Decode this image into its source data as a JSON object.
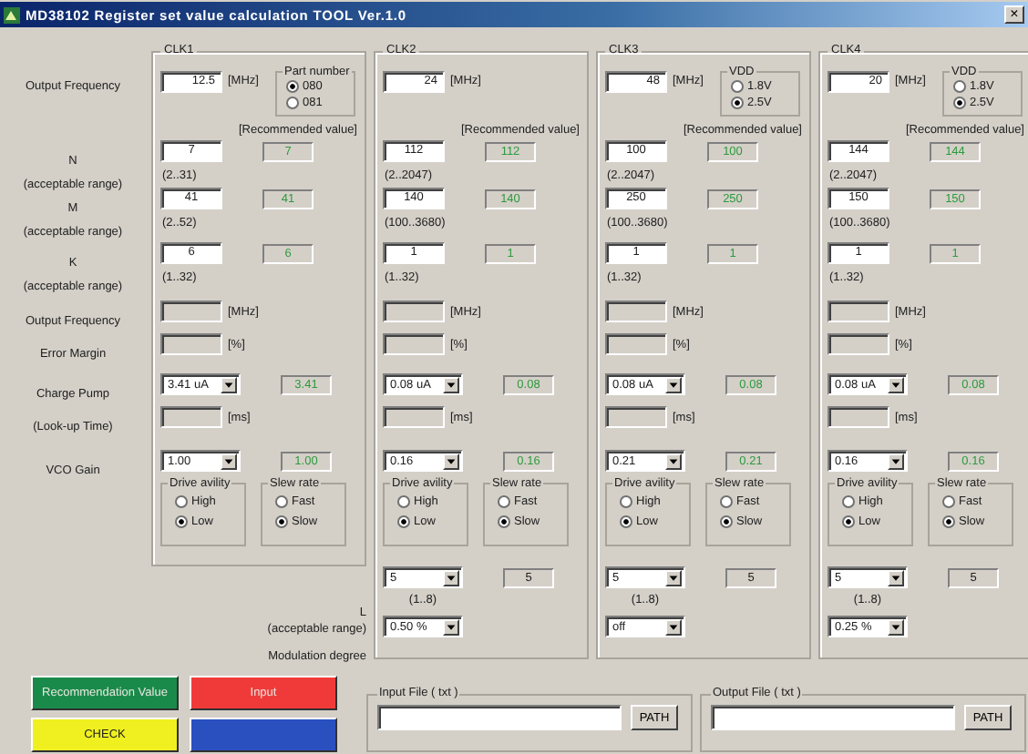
{
  "window": {
    "title": "MD38102 Register set value calculation TOOL Ver.1.0",
    "close": "×"
  },
  "label_column": {
    "output_frequency": "Output Frequency",
    "n": "N",
    "n_range": "(acceptable range)",
    "m": "M",
    "m_range": "(acceptable range)",
    "k": "K",
    "k_range": "(acceptable range)",
    "output_frequency_2": "Output Frequency",
    "error_margin": "Error Margin",
    "charge_pump": "Charge Pump",
    "lookup_time": "(Look-up Time)",
    "vco_gain": "VCO Gain",
    "l": "L",
    "l_range": "(acceptable range)",
    "modulation_degree": "Modulation degree"
  },
  "clocks": [
    {
      "title": "CLK1",
      "frequency": "12.5",
      "frequency_unit": "[MHz]",
      "option_group": {
        "title": "Part number",
        "options": [
          {
            "label": "080",
            "selected": true
          },
          {
            "label": "081",
            "selected": false
          }
        ]
      },
      "recommended_header": "[Recommended value]",
      "n": {
        "value": "7",
        "recommended": "7",
        "range": "(2..31)"
      },
      "m": {
        "value": "41",
        "recommended": "41",
        "range": "(2..52)"
      },
      "k": {
        "value": "6",
        "recommended": "6",
        "range": "(1..32)"
      },
      "output_frequency_unit": "[MHz]",
      "error_margin_unit": "[%]",
      "charge_pump": {
        "value": "3.41 uA",
        "recommended": "3.41"
      },
      "lookup_time_unit": "[ms]",
      "vco_gain": {
        "value": "1.00",
        "recommended": "1.00"
      },
      "drive_ability": {
        "title": "Drive avility",
        "options": [
          {
            "label": "High",
            "selected": false
          },
          {
            "label": "Low",
            "selected": true
          }
        ]
      },
      "slew_rate": {
        "title": "Slew rate",
        "options": [
          {
            "label": "Fast",
            "selected": false
          },
          {
            "label": "Slow",
            "selected": true
          }
        ]
      }
    },
    {
      "title": "CLK2",
      "frequency": "24",
      "frequency_unit": "[MHz]",
      "recommended_header": "[Recommended value]",
      "n": {
        "value": "112",
        "recommended": "112",
        "range": "(2..2047)"
      },
      "m": {
        "value": "140",
        "recommended": "140",
        "range": "(100..3680)"
      },
      "k": {
        "value": "1",
        "recommended": "1",
        "range": "(1..32)"
      },
      "output_frequency_unit": "[MHz]",
      "error_margin_unit": "[%]",
      "charge_pump": {
        "value": "0.08 uA",
        "recommended": "0.08"
      },
      "lookup_time_unit": "[ms]",
      "vco_gain": {
        "value": "0.16",
        "recommended": "0.16"
      },
      "drive_ability": {
        "title": "Drive avility",
        "options": [
          {
            "label": "High",
            "selected": false
          },
          {
            "label": "Low",
            "selected": true
          }
        ]
      },
      "slew_rate": {
        "title": "Slew rate",
        "options": [
          {
            "label": "Fast",
            "selected": false
          },
          {
            "label": "Slow",
            "selected": true
          }
        ]
      },
      "l": {
        "value": "5",
        "recommended": "5",
        "range": "(1..8)"
      },
      "modulation": "0.50 %"
    },
    {
      "title": "CLK3",
      "frequency": "48",
      "frequency_unit": "[MHz]",
      "option_group": {
        "title": "VDD",
        "options": [
          {
            "label": "1.8V",
            "selected": false
          },
          {
            "label": "2.5V",
            "selected": true
          }
        ]
      },
      "recommended_header": "[Recommended value]",
      "n": {
        "value": "100",
        "recommended": "100",
        "range": "(2..2047)"
      },
      "m": {
        "value": "250",
        "recommended": "250",
        "range": "(100..3680)"
      },
      "k": {
        "value": "1",
        "recommended": "1",
        "range": "(1..32)"
      },
      "output_frequency_unit": "[MHz]",
      "error_margin_unit": "[%]",
      "charge_pump": {
        "value": "0.08 uA",
        "recommended": "0.08"
      },
      "lookup_time_unit": "[ms]",
      "vco_gain": {
        "value": "0.21",
        "recommended": "0.21"
      },
      "drive_ability": {
        "title": "Drive avility",
        "options": [
          {
            "label": "High",
            "selected": false
          },
          {
            "label": "Low",
            "selected": true
          }
        ]
      },
      "slew_rate": {
        "title": "Slew rate",
        "options": [
          {
            "label": "Fast",
            "selected": false
          },
          {
            "label": "Slow",
            "selected": true
          }
        ]
      },
      "l": {
        "value": "5",
        "recommended": "5",
        "range": "(1..8)"
      },
      "modulation": "off"
    },
    {
      "title": "CLK4",
      "frequency": "20",
      "frequency_unit": "[MHz]",
      "option_group": {
        "title": "VDD",
        "options": [
          {
            "label": "1.8V",
            "selected": false
          },
          {
            "label": "2.5V",
            "selected": true
          }
        ]
      },
      "recommended_header": "[Recommended value]",
      "n": {
        "value": "144",
        "recommended": "144",
        "range": "(2..2047)"
      },
      "m": {
        "value": "150",
        "recommended": "150",
        "range": "(100..3680)"
      },
      "k": {
        "value": "1",
        "recommended": "1",
        "range": "(1..32)"
      },
      "output_frequency_unit": "[MHz]",
      "error_margin_unit": "[%]",
      "charge_pump": {
        "value": "0.08 uA",
        "recommended": "0.08"
      },
      "lookup_time_unit": "[ms]",
      "vco_gain": {
        "value": "0.16",
        "recommended": "0.16"
      },
      "drive_ability": {
        "title": "Drive avility",
        "options": [
          {
            "label": "High",
            "selected": false
          },
          {
            "label": "Low",
            "selected": true
          }
        ]
      },
      "slew_rate": {
        "title": "Slew rate",
        "options": [
          {
            "label": "Fast",
            "selected": false
          },
          {
            "label": "Slow",
            "selected": true
          }
        ]
      },
      "l": {
        "value": "5",
        "recommended": "5",
        "range": "(1..8)"
      },
      "modulation": "0.25 %"
    }
  ],
  "buttons": [
    {
      "label": "Recommendation Value",
      "color": "#1a8a4a"
    },
    {
      "label": "Input",
      "color": "#f03a3a"
    },
    {
      "label": "CHECK",
      "color": "#f0f020"
    },
    {
      "color": "#2a50c0"
    }
  ],
  "input_file": {
    "title": "Input File ( txt )",
    "button": "PATH"
  },
  "output_file": {
    "title": "Output File ( txt )",
    "button": "PATH"
  }
}
